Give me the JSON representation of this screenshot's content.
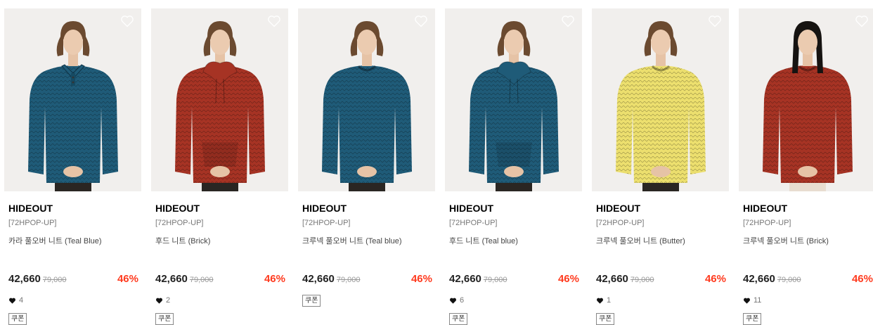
{
  "colors": {
    "discount": "#ff3b1f",
    "teal": "#1f5b78",
    "brick": "#a63324",
    "butter": "#ecdf6e"
  },
  "coupon_label": "쿠폰",
  "products": [
    {
      "brand": "HIDEOUT",
      "tag": "[72HPOP-UP]",
      "name": "카라 풀오버 니트 (Teal Blue)",
      "price": "42,660",
      "original_price": "79,000",
      "discount": "46%",
      "likes": "4",
      "has_likes": true,
      "has_coupon": true,
      "sweater_color": "#1f5b78",
      "style": "collar",
      "model": "male"
    },
    {
      "brand": "HIDEOUT",
      "tag": "[72HPOP-UP]",
      "name": "후드 니트 (Brick)",
      "price": "42,660",
      "original_price": "79,000",
      "discount": "46%",
      "likes": "2",
      "has_likes": true,
      "has_coupon": true,
      "sweater_color": "#a63324",
      "style": "hood",
      "model": "male"
    },
    {
      "brand": "HIDEOUT",
      "tag": "[72HPOP-UP]",
      "name": "크루넥 풀오버 니트 (Teal blue)",
      "price": "42,660",
      "original_price": "79,000",
      "discount": "46%",
      "likes": "",
      "has_likes": false,
      "has_coupon": true,
      "sweater_color": "#1f5b78",
      "style": "crew",
      "model": "male"
    },
    {
      "brand": "HIDEOUT",
      "tag": "[72HPOP-UP]",
      "name": "후드 니트 (Teal blue)",
      "price": "42,660",
      "original_price": "79,000",
      "discount": "46%",
      "likes": "6",
      "has_likes": true,
      "has_coupon": true,
      "sweater_color": "#1f5b78",
      "style": "hood",
      "model": "male"
    },
    {
      "brand": "HIDEOUT",
      "tag": "[72HPOP-UP]",
      "name": "크루넥 풀오버 니트 (Butter)",
      "price": "42,660",
      "original_price": "79,000",
      "discount": "46%",
      "likes": "1",
      "has_likes": true,
      "has_coupon": true,
      "sweater_color": "#ecdf6e",
      "style": "crew",
      "model": "male"
    },
    {
      "brand": "HIDEOUT",
      "tag": "[72HPOP-UP]",
      "name": "크루넥 풀오버 니트 (Brick)",
      "price": "42,660",
      "original_price": "79,000",
      "discount": "46%",
      "likes": "11",
      "has_likes": true,
      "has_coupon": true,
      "sweater_color": "#a63324",
      "style": "crew",
      "model": "female"
    }
  ]
}
